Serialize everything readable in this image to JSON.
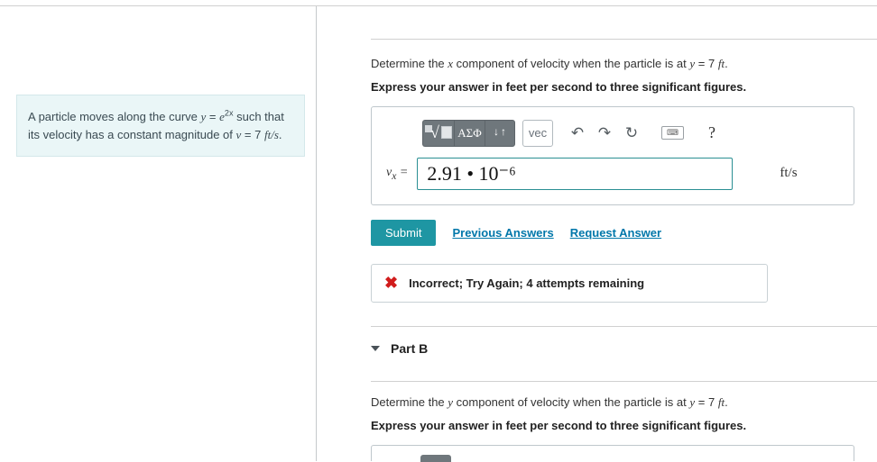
{
  "problem": {
    "text_before_eq": "A particle moves along the curve ",
    "eq_lhs": "y",
    "eq_rhs_base": "e",
    "eq_rhs_exp": "2x",
    "text_after_eq": " such that its velocity has a constant magnitude of ",
    "v_var": "v",
    "v_value": "7",
    "v_unit": "ft/s",
    "period": "."
  },
  "partA": {
    "prompt_before": "Determine the ",
    "prompt_var": "x",
    "prompt_after": " component of velocity when the particle is at ",
    "at_var": "y",
    "at_value": "7",
    "at_unit": "ft",
    "period": ".",
    "instruction": "Express your answer in feet per second to three significant figures.",
    "answer_var": "v",
    "answer_sub": "x",
    "answer_value": "2.91 • 10⁻⁶",
    "answer_unit": "ft/s",
    "submit_label": "Submit",
    "prev_label": "Previous Answers",
    "request_label": "Request Answer",
    "feedback": "Incorrect; Try Again; 4 attempts remaining"
  },
  "toolbar": {
    "greek_label": "ΑΣΦ",
    "vec_label": "vec",
    "help_symbol": "?"
  },
  "partB": {
    "title": "Part B",
    "prompt_before": "Determine the ",
    "prompt_var": "y",
    "prompt_after": " component of velocity when the particle is at ",
    "at_var": "y",
    "at_value": "7",
    "at_unit": "ft",
    "period": ".",
    "instruction": "Express your answer in feet per second to three significant figures."
  }
}
